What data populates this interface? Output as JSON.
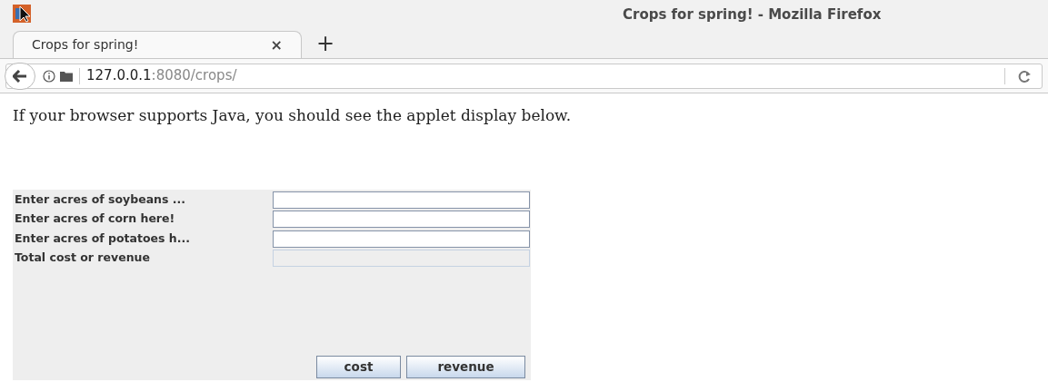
{
  "window": {
    "title": "Crops for spring! - Mozilla Firefox"
  },
  "tabs": [
    {
      "label": "Crops for spring!",
      "close": "×",
      "selected": true
    }
  ],
  "new_tab": "+",
  "address_bar": {
    "host": "127.0.0.1",
    "rest": ":8080/crops/"
  },
  "page_text": "If your browser supports Java, you should see the applet display below.",
  "applet": {
    "fields": [
      {
        "label": "Enter acres of soybeans ...",
        "disabled": false
      },
      {
        "label": "Enter acres of corn here!",
        "disabled": false
      },
      {
        "label": "Enter acres of potatoes h...",
        "disabled": false
      },
      {
        "label": "Total cost or revenue",
        "disabled": true
      }
    ],
    "buttons": [
      "cost",
      "revenue"
    ]
  }
}
